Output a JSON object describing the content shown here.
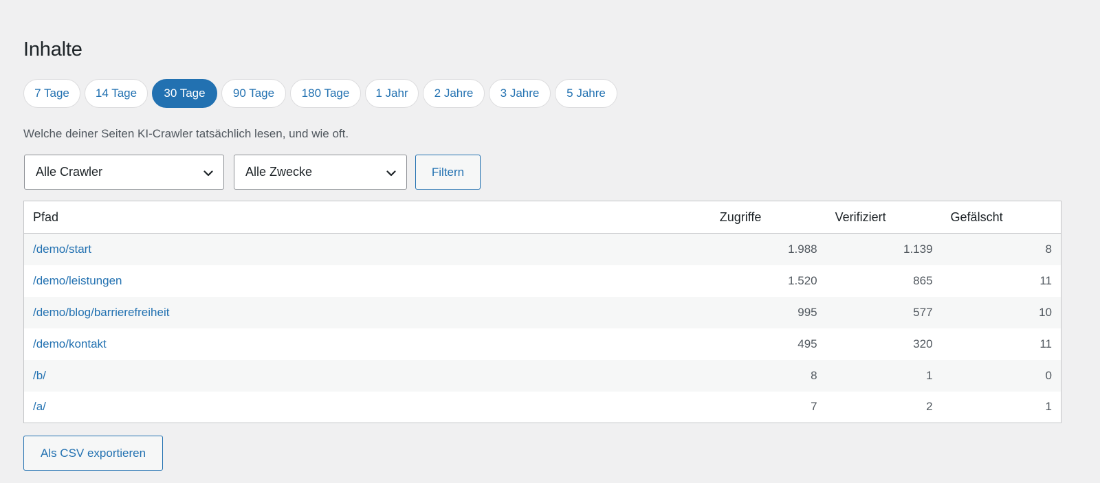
{
  "page": {
    "title": "Inhalte",
    "description": "Welche deiner Seiten KI-Crawler tatsächlich lesen, und wie oft."
  },
  "ranges": [
    {
      "label": "7 Tage",
      "active": false
    },
    {
      "label": "14 Tage",
      "active": false
    },
    {
      "label": "30 Tage",
      "active": true
    },
    {
      "label": "90 Tage",
      "active": false
    },
    {
      "label": "180 Tage",
      "active": false
    },
    {
      "label": "1 Jahr",
      "active": false
    },
    {
      "label": "2 Jahre",
      "active": false
    },
    {
      "label": "3 Jahre",
      "active": false
    },
    {
      "label": "5 Jahre",
      "active": false
    }
  ],
  "filters": {
    "crawler_select": "Alle Crawler",
    "purpose_select": "Alle Zwecke",
    "filter_button": "Filtern"
  },
  "table": {
    "headers": {
      "path": "Pfad",
      "hits": "Zugriffe",
      "verified": "Verifiziert",
      "fake": "Gefälscht"
    },
    "rows": [
      {
        "path": "/demo/start",
        "hits": "1.988",
        "verified": "1.139",
        "fake": "8"
      },
      {
        "path": "/demo/leistungen",
        "hits": "1.520",
        "verified": "865",
        "fake": "11"
      },
      {
        "path": "/demo/blog/barrierefreiheit",
        "hits": "995",
        "verified": "577",
        "fake": "10"
      },
      {
        "path": "/demo/kontakt",
        "hits": "495",
        "verified": "320",
        "fake": "11"
      },
      {
        "path": "/b/",
        "hits": "8",
        "verified": "1",
        "fake": "0"
      },
      {
        "path": "/a/",
        "hits": "7",
        "verified": "2",
        "fake": "1"
      }
    ]
  },
  "export_button": "Als CSV exportieren",
  "colors": {
    "accent": "#2271b1",
    "background": "#f0f0f1",
    "stripe": "#f6f7f7"
  },
  "icons": {
    "select_arrow": "chevron-down-icon"
  }
}
